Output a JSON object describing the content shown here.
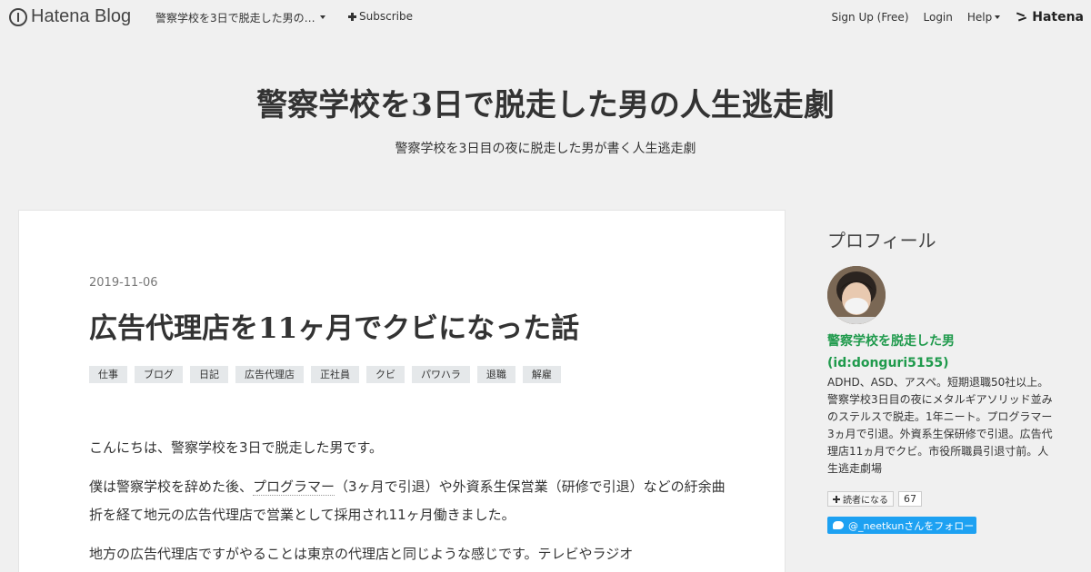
{
  "header": {
    "logo": "Hatena Blog",
    "blog_name": "警察学校を3日で脱走した男の…",
    "subscribe": "Subscribe",
    "signup": "Sign Up (Free)",
    "login": "Login",
    "help": "Help",
    "hatena": "Hatena"
  },
  "blog": {
    "title": "警察学校を3日で脱走した男の人生逃走劇",
    "description": "警察学校を3日目の夜に脱走した男が書く人生逃走劇"
  },
  "entry": {
    "date": "2019-11-06",
    "title": "広告代理店を11ヶ月でクビになった話",
    "tags": [
      "仕事",
      "ブログ",
      "日記",
      "広告代理店",
      "正社員",
      "クビ",
      "パワハラ",
      "退職",
      "解雇"
    ],
    "p1": "こんにちは、警察学校を3日で脱走した男です。",
    "p2_a": "僕は警察学校を辞めた後、",
    "p2_link": "プログラマー",
    "p2_b": "（3ヶ月で引退）や外資系生保営業（研修で引退）などの紆余曲折を経て地元の広告代理店で営業として採用され11ヶ月働きました。",
    "p3": "地方の広告代理店ですがやることは東京の代理店と同じような感じです。テレビやラジオ"
  },
  "sidebar": {
    "heading": "プロフィール",
    "name": "警察学校を脱走した男",
    "id": "(id:donguri5155)",
    "bio": "ADHD、ASD、アスペ。短期退職50社以上。警察学校3日目の夜にメタルギアソリッド並みのステルスで脱走。1年ニート。プログラマー3ヵ月で引退。外資系生保研修で引退。広告代理店11ヵ月でクビ。市役所職員引退寸前。人生逃走劇場",
    "reader_button": "読者になる",
    "reader_count": "67",
    "follow": "@_neetkunさんをフォロー"
  }
}
